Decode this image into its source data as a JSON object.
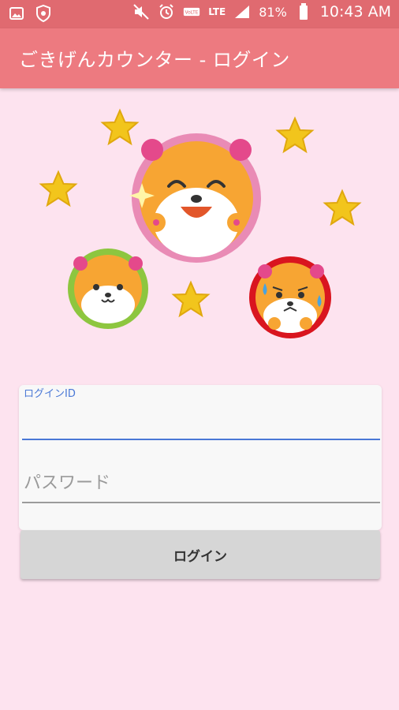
{
  "status_bar": {
    "signal_label": "LTE",
    "battery_percent": "81%",
    "time": "10:43 AM",
    "icons": [
      "gallery-icon",
      "shield-icon",
      "mute-icon",
      "alarm-icon",
      "volte-icon",
      "signal-icon",
      "battery-icon"
    ]
  },
  "app_bar": {
    "title": "ごきげんカウンター - ログイン"
  },
  "form": {
    "id_label": "ログインID",
    "id_value": "",
    "password_placeholder": "パスワード",
    "password_value": ""
  },
  "login_button": {
    "label": "ログイン"
  },
  "colors": {
    "status_bar": "#e06a70",
    "app_bar": "#ed7a80",
    "background": "#fde3ef",
    "accent": "#4a78d6",
    "star": "#f2c51c"
  }
}
